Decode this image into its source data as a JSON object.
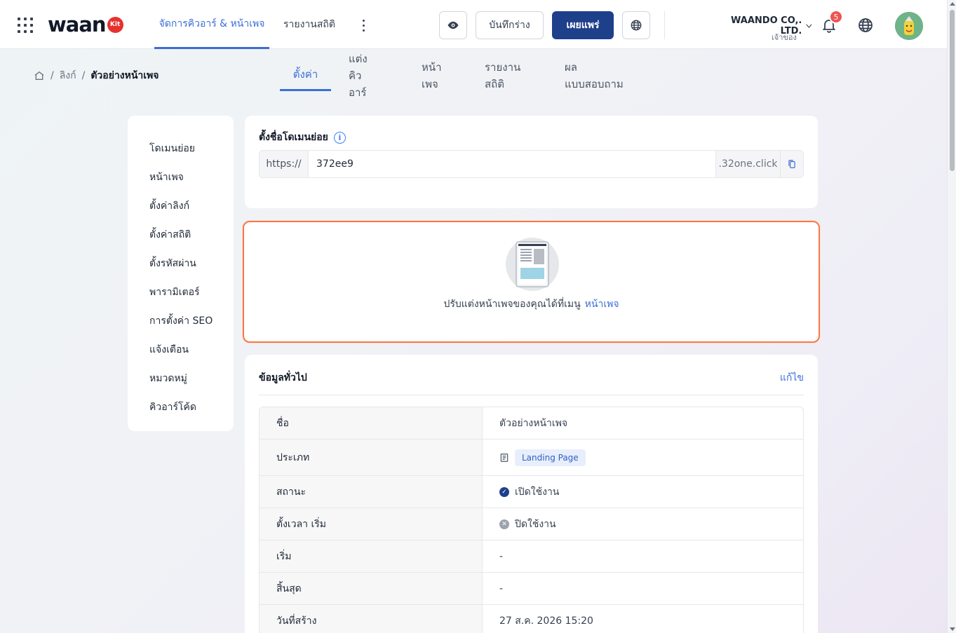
{
  "app": {
    "logo_text": "waan",
    "logo_badge": "Kit"
  },
  "nav": {
    "items": [
      {
        "label": "จัดการคิวอาร์ & หน้าเพจ",
        "active": true
      },
      {
        "label": "รายงานสถิติ",
        "active": false
      }
    ],
    "more_icon": "kebab-vertical-icon"
  },
  "toolbar": {
    "preview_icon": "eye-icon",
    "draft_label": "บันทึกร่าง",
    "publish_label": "เผยแพร่",
    "language_icon": "globe-icon"
  },
  "account": {
    "org_name": "WAANDO CO,. LTD.",
    "role": "เจ้าของ",
    "notification_count": "5"
  },
  "breadcrumb": {
    "home_icon": "home-icon",
    "items": [
      "ลิงก์",
      "ตัวอย่างหน้าเพจ"
    ],
    "separator": "/"
  },
  "tabs": [
    {
      "label": "ตั้งค่า",
      "active": true
    },
    {
      "label": "แต่งคิวอาร์",
      "active": false
    },
    {
      "label": "หน้าเพจ",
      "active": false
    },
    {
      "label": "รายงานสถิติ",
      "active": false
    },
    {
      "label": "ผลแบบสอบถาม",
      "active": false
    }
  ],
  "sidemenu": {
    "items": [
      "โดเมนย่อย",
      "หน้าเพจ",
      "ตั้งค่าลิงก์",
      "ตั้งค่าสถิติ",
      "ตั้งรหัสผ่าน",
      "พารามิเตอร์",
      "การตั้งค่า SEO",
      "แจ้งเตือน",
      "หมวดหมู่",
      "คิวอาร์โค้ด"
    ]
  },
  "subdomain": {
    "title": "ตั้งชื่อโดเมนย่อย",
    "info_icon": "i",
    "prefix": "https://",
    "value": "372ee9",
    "suffix": ".32one.click"
  },
  "hint": {
    "text": "ปรับแต่งหน้าเพจของคุณได้ที่เมนู",
    "link": "หน้าเพจ"
  },
  "general": {
    "title": "ข้อมูลทั่วไป",
    "edit_label": "แก้ไข",
    "rows": [
      {
        "key": "ชื่อ",
        "value": "ตัวอย่างหน้าเพจ"
      },
      {
        "key": "ประเภท",
        "value": "Landing Page"
      },
      {
        "key": "สถานะ",
        "value": "เปิดใช้งาน"
      },
      {
        "key": "ตั้งเวลา เริ่ม",
        "value": "ปิดใช้งาน"
      },
      {
        "key": "เริ่ม",
        "value": "-"
      },
      {
        "key": "สิ้นสุด",
        "value": "-"
      },
      {
        "key": "วันที่สร้าง",
        "value": "27 ส.ค. 2026 15:20"
      }
    ]
  },
  "colors": {
    "accent": "#3b6fd6",
    "primary_button": "#1e3f8a",
    "highlight_border": "#f47a4a",
    "badge_red": "#ef5350"
  }
}
